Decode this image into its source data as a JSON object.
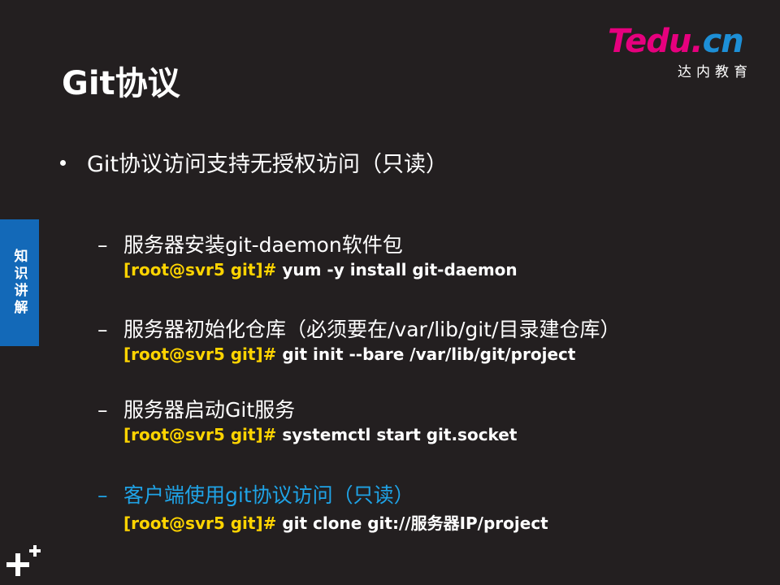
{
  "slide": {
    "title": "Git协议"
  },
  "logo": {
    "brand_t": "T",
    "brand_rest": "edu.",
    "brand_cn": "cn",
    "subtitle": "达内教育"
  },
  "side_tab": {
    "label": "知识讲解"
  },
  "bullet": {
    "text": "Git协议访问支持无授权访问（只读）"
  },
  "steps": [
    {
      "dash": "–",
      "text": "服务器安装git-daemon软件包",
      "prompt": "[root@svr5 git]#",
      "command": " yum -y install git-daemon"
    },
    {
      "dash": "–",
      "text": "服务器初始化仓库（必须要在/var/lib/git/目录建仓库）",
      "prompt": "[root@svr5 git]#",
      "command": " git init --bare  /var/lib/git/project"
    },
    {
      "dash": "–",
      "text": "服务器启动Git服务",
      "prompt": "[root@svr5 git]#",
      "command": " systemctl  start  git.socket"
    },
    {
      "dash": "–",
      "text": "客户端使用git协议访问（只读）",
      "prompt": "[root@svr5 git]#",
      "command": " git clone git://服务器IP/project"
    }
  ],
  "colors": {
    "background": "#231f20",
    "prompt": "#ffd400",
    "highlight": "#1fa3e6",
    "side_tab": "#1369b8"
  },
  "icons": {
    "corner": "plus-icon"
  }
}
